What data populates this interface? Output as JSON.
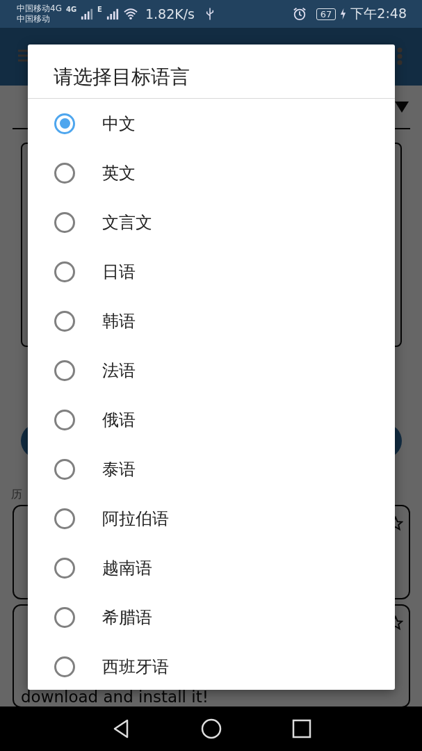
{
  "status_bar": {
    "carrier_primary": "中国移动4G",
    "carrier_secondary": "中国移动",
    "network_primary": "4G",
    "network_secondary": "E",
    "speed": "1.82K/s",
    "battery": "67",
    "time": "下午2:48"
  },
  "background": {
    "history_label": "历",
    "history_card_text": "download and install it!"
  },
  "dialog": {
    "title": "请选择目标语言",
    "options": [
      {
        "label": "中文",
        "selected": true
      },
      {
        "label": "英文",
        "selected": false
      },
      {
        "label": "文言文",
        "selected": false
      },
      {
        "label": "日语",
        "selected": false
      },
      {
        "label": "韩语",
        "selected": false
      },
      {
        "label": "法语",
        "selected": false
      },
      {
        "label": "俄语",
        "selected": false
      },
      {
        "label": "泰语",
        "selected": false
      },
      {
        "label": "阿拉伯语",
        "selected": false
      },
      {
        "label": "越南语",
        "selected": false
      },
      {
        "label": "希腊语",
        "selected": false
      },
      {
        "label": "西班牙语",
        "selected": false
      }
    ]
  }
}
